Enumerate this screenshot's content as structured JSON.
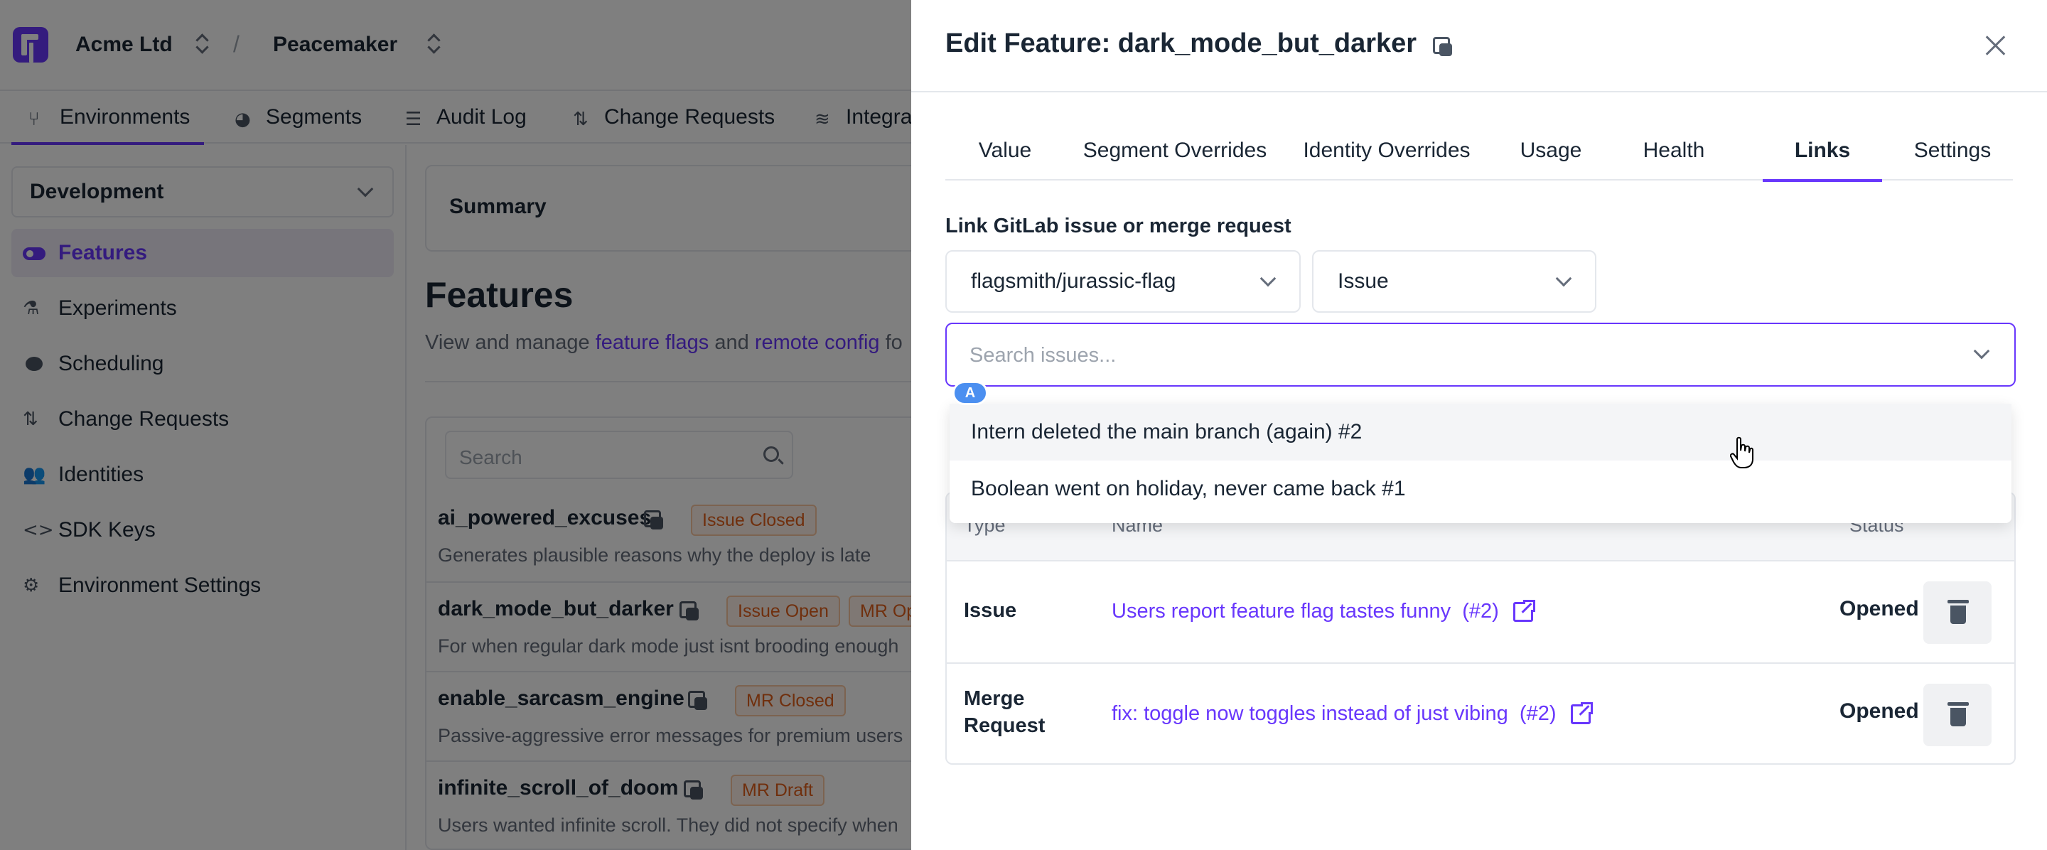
{
  "topbar": {
    "organisation": "Acme Ltd",
    "separator": "/",
    "project": "Peacemaker"
  },
  "nav_tabs": [
    {
      "label": "Environments",
      "icon": "branch-icon",
      "active": true
    },
    {
      "label": "Segments",
      "icon": "pie-chart-icon",
      "active": false
    },
    {
      "label": "Audit Log",
      "icon": "list-icon",
      "active": false
    },
    {
      "label": "Change Requests",
      "icon": "pull-request-icon",
      "active": false
    },
    {
      "label": "Integra",
      "icon": "layers-icon",
      "active": false
    }
  ],
  "sidebar": {
    "environment": "Development",
    "items": [
      {
        "label": "Features",
        "icon": "toggle-icon",
        "active": true
      },
      {
        "label": "Experiments",
        "icon": "flask-icon",
        "active": false
      },
      {
        "label": "Scheduling",
        "icon": "clock-icon",
        "active": false
      },
      {
        "label": "Change Requests",
        "icon": "pull-request-icon",
        "active": false
      },
      {
        "label": "Identities",
        "icon": "users-icon",
        "active": false
      },
      {
        "label": "SDK Keys",
        "icon": "code-icon",
        "active": false
      },
      {
        "label": "Environment Settings",
        "icon": "gear-icon",
        "active": false
      }
    ]
  },
  "main": {
    "summary_label": "Summary",
    "title": "Features",
    "subtitle_pre": "View and manage ",
    "subtitle_link1": "feature flags",
    "subtitle_mid": " and ",
    "subtitle_link2": "remote config",
    "subtitle_post": " fo",
    "search_placeholder": "Search",
    "features": [
      {
        "name": "ai_powered_excuses",
        "description": "Generates plausible reasons why the deploy is late",
        "tags": [
          "Issue Closed"
        ]
      },
      {
        "name": "dark_mode_but_darker",
        "description": "For when regular dark mode just isnt brooding enough",
        "tags": [
          "Issue Open",
          "MR Op"
        ]
      },
      {
        "name": "enable_sarcasm_engine",
        "description": "Passive-aggressive error messages for premium users",
        "tags": [
          "MR Closed"
        ]
      },
      {
        "name": "infinite_scroll_of_doom",
        "description": "Users wanted infinite scroll. They did not specify when",
        "tags": [
          "MR Draft"
        ]
      }
    ]
  },
  "panel": {
    "title": "Edit Feature: dark_mode_but_darker",
    "tabs": [
      {
        "label": "Value",
        "active": false
      },
      {
        "label": "Segment Overrides",
        "active": false
      },
      {
        "label": "Identity Overrides",
        "active": false
      },
      {
        "label": "Usage",
        "active": false
      },
      {
        "label": "Health",
        "active": false
      },
      {
        "label": "Links",
        "active": true
      },
      {
        "label": "Settings",
        "active": false
      }
    ],
    "link_label": "Link GitLab issue or merge request",
    "repo_select": "flagsmith/jurassic-flag",
    "type_select": "Issue",
    "search_placeholder": "Search issues...",
    "badge": "A",
    "dropdown_options": [
      "Intern deleted the main branch (again) #2",
      "Boolean went on holiday, never came back #1"
    ],
    "table": {
      "headers": {
        "type": "Type",
        "name": "Name",
        "status": "Status"
      },
      "rows": [
        {
          "type": "Issue",
          "name": "Users report feature flag tastes funny",
          "number": "(#2)",
          "status": "Opened"
        },
        {
          "type": "Merge Request",
          "name": "fix: toggle now toggles instead of just vibing",
          "number": "(#2)",
          "status": "Opened"
        }
      ]
    }
  },
  "colors": {
    "accent": "#6837fc",
    "tag_orange": "#e05f1a",
    "overlay": "#000000"
  }
}
